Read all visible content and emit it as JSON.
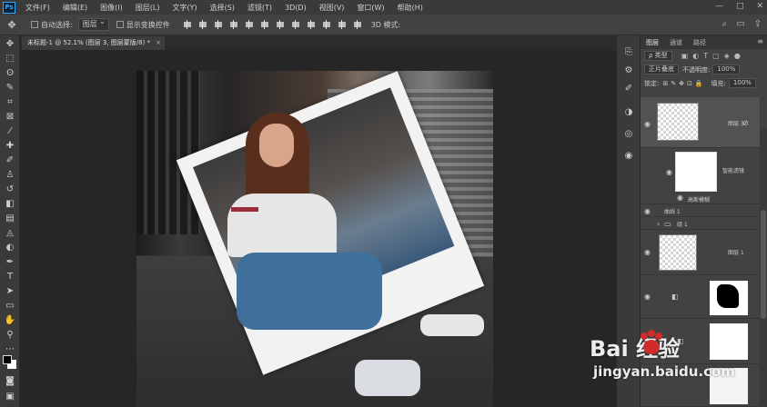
{
  "app": {
    "logo": "Ps"
  },
  "menu": [
    "文件(F)",
    "编辑(E)",
    "图像(I)",
    "图层(L)",
    "文字(Y)",
    "选择(S)",
    "滤镜(T)",
    "3D(D)",
    "视图(V)",
    "窗口(W)",
    "帮助(H)"
  ],
  "window_controls": {
    "minimize": "—",
    "maximize": "□",
    "close": "✕"
  },
  "options": {
    "auto_select_label": "自动选择:",
    "auto_select_value": "图层",
    "transform_label": "显示变换控件",
    "mode3d_label": "3D 模式:"
  },
  "document_tab": {
    "title": "未标题-1 @ 52.1% (图层 3, 图层蒙版/8) *",
    "close": "×"
  },
  "layers_panel": {
    "tabs": [
      "图层",
      "通道",
      "路径"
    ],
    "menu": "≡",
    "filter_kind": "ρ 类型",
    "blend_mode": "正片叠底",
    "opacity_label": "不透明度:",
    "opacity_value": "100%",
    "lock_label": "锁定:",
    "fill_label": "填充:",
    "fill_value": "100%",
    "layers": [
      {
        "name": "图层 3"
      },
      {
        "name": "曲线 1"
      },
      {
        "name": "组 1"
      },
      {
        "name": "图层 1"
      }
    ],
    "mask_labels": [
      "智能滤镜",
      "高斯模糊"
    ]
  },
  "watermark": {
    "brand": "Bai 经验",
    "url": "jingyan.baidu.com"
  },
  "colors": {
    "menubar": "#3a3a3a",
    "panel": "#424242",
    "canvas": "#262626",
    "accent": "#31a8ff"
  }
}
